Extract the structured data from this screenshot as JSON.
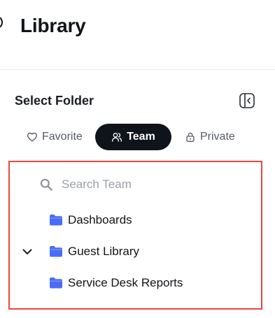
{
  "header": {
    "title": "Library"
  },
  "folder_selector": {
    "title": "Select Folder",
    "tabs": [
      {
        "label": "Favorite",
        "icon": "heart-icon",
        "active": false
      },
      {
        "label": "Team",
        "icon": "users-icon",
        "active": true
      },
      {
        "label": "Private",
        "icon": "lock-icon",
        "active": false
      }
    ],
    "search": {
      "placeholder": "Search Team",
      "value": ""
    },
    "folders": [
      {
        "label": "Dashboards",
        "icon": "folder-icon",
        "expandable": false
      },
      {
        "label": "Guest Library",
        "icon": "folder-icon",
        "expandable": true,
        "expanded": true
      },
      {
        "label": "Service Desk Reports",
        "icon": "folder-icon",
        "expandable": false
      }
    ]
  },
  "colors": {
    "accent_dark": "#0f131a",
    "folder_blue": "#4a6cf7",
    "highlight_border": "#e8483d"
  }
}
